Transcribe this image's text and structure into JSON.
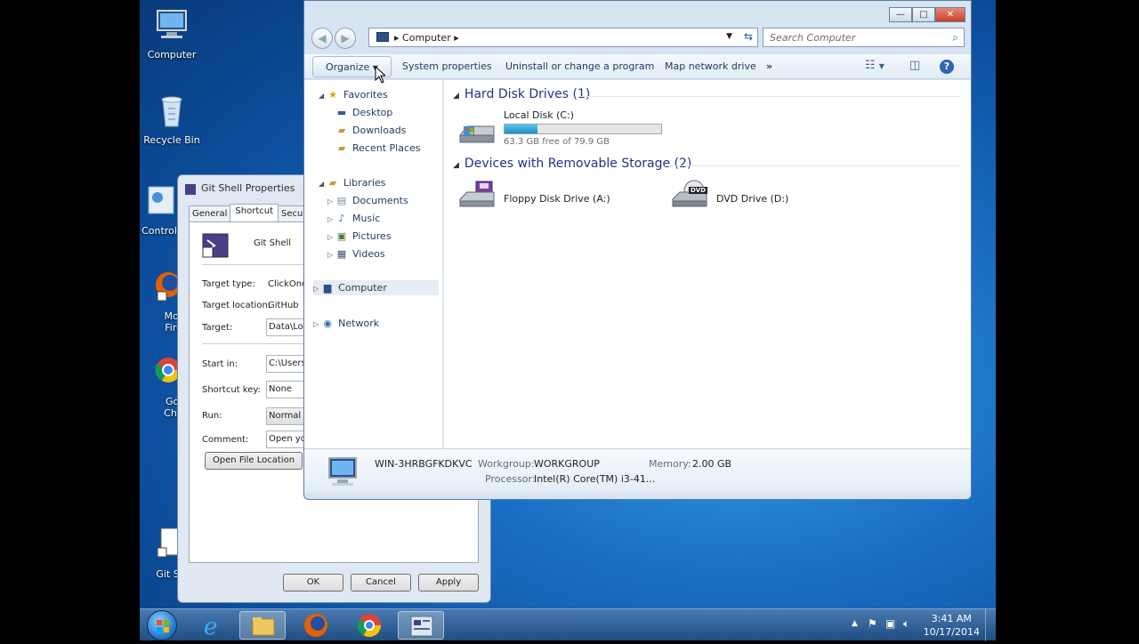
{
  "desktop": {
    "icons": [
      {
        "label": "Computer"
      },
      {
        "label": "Recycle Bin"
      },
      {
        "label": "Control"
      },
      {
        "label": "Mozi Firef"
      },
      {
        "label": "Goo Chro"
      },
      {
        "label": "Git Sh"
      }
    ]
  },
  "properties": {
    "title": "Git Shell Properties",
    "tabs": [
      "General",
      "Shortcut",
      "Securi"
    ],
    "name": "Git Shell",
    "target_type_label": "Target type:",
    "target_type_value": "ClickOnce",
    "target_location_label": "Target location:",
    "target_location_value": "GitHub",
    "target_label": "Target:",
    "target_value": "Data\\Loca",
    "start_in_label": "Start in:",
    "start_in_value": "C:\\Users",
    "shortcut_key_label": "Shortcut key:",
    "shortcut_key_value": "None",
    "run_label": "Run:",
    "run_value": "Normal w",
    "comment_label": "Comment:",
    "comment_value": "Open you",
    "open_file_location": "Open File Location",
    "ok": "OK",
    "cancel": "Cancel",
    "apply": "Apply"
  },
  "explorer": {
    "window_buttons": {
      "minimize": "—",
      "maximize": "□",
      "close": "✕"
    },
    "address": "Computer",
    "search_placeholder": "Search Computer",
    "toolbar": {
      "organize": "Organize",
      "system_properties": "System properties",
      "uninstall": "Uninstall or change a program",
      "map_network": "Map network drive",
      "more": "»"
    },
    "nav": {
      "favorites": "Favorites",
      "desktop": "Desktop",
      "downloads": "Downloads",
      "recent": "Recent Places",
      "libraries": "Libraries",
      "documents": "Documents",
      "music": "Music",
      "pictures": "Pictures",
      "videos": "Videos",
      "computer": "Computer",
      "network": "Network"
    },
    "groups": {
      "hdd": "Hard Disk Drives (1)",
      "removable": "Devices with Removable Storage (2)"
    },
    "drives": {
      "local_name": "Local Disk (C:)",
      "local_free": "63.3 GB free of 79.9 GB",
      "local_used_fraction": 0.21,
      "floppy": "Floppy Disk Drive (A:)",
      "dvd": "DVD Drive (D:)",
      "dvd_badge": "DVD"
    },
    "details": {
      "name": "WIN-3HRBGFKDKVC",
      "workgroup_label": "Workgroup:",
      "workgroup_value": "WORKGROUP",
      "memory_label": "Memory:",
      "memory_value": "2.00 GB",
      "processor_label": "Processor:",
      "processor_value": "Intel(R) Core(TM) i3-41..."
    }
  },
  "taskbar": {
    "time": "3:41 AM",
    "date": "10/17/2014"
  }
}
